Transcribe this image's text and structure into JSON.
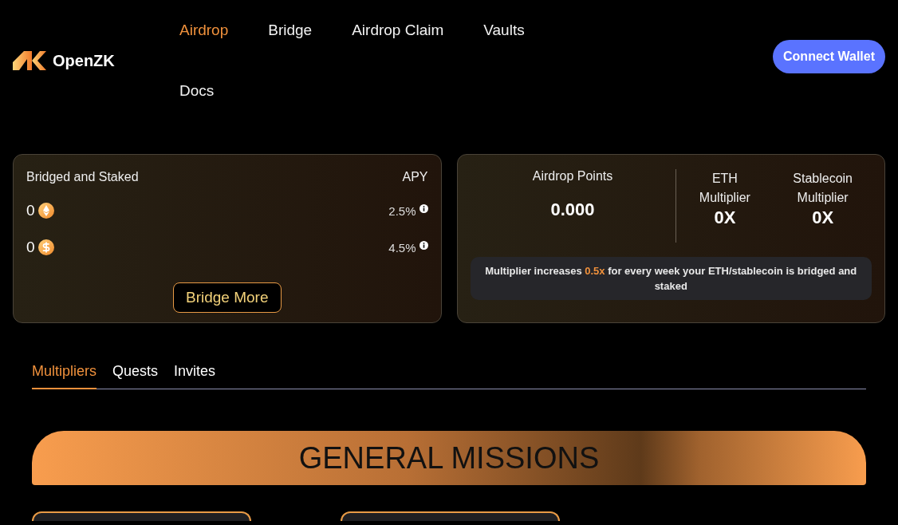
{
  "logo": {
    "name": "OpenZK"
  },
  "nav": [
    {
      "label": "Airdrop",
      "selected": true
    },
    {
      "label": "Bridge",
      "selected": false
    },
    {
      "label": "Airdrop Claim",
      "selected": false
    },
    {
      "label": "Vaults",
      "selected": false
    },
    {
      "label": "Docs",
      "selected": false
    }
  ],
  "connect_button": "Connect Wallet",
  "staked_card": {
    "title": "Bridged and Staked",
    "apy_header": "APY",
    "assets": [
      {
        "kind": "eth",
        "amount": "0",
        "apy": "2.5%"
      },
      {
        "kind": "usd",
        "amount": "0",
        "apy": "4.5%"
      }
    ],
    "button": "Bridge More"
  },
  "points_card": {
    "points_label": "Airdrop Points",
    "points_value": "0.000",
    "multipliers": [
      {
        "label": "ETH Multiplier",
        "value": "0X"
      },
      {
        "label": "Stablecoin Multiplier",
        "value": "0X"
      }
    ],
    "note": "Multiplier increases **0.5x** for every week your ETH/stablecoin is bridged and staked"
  },
  "tabs": [
    {
      "label": "Multipliers",
      "selected": true
    },
    {
      "label": "Quests",
      "selected": false
    },
    {
      "label": "Invites",
      "selected": false
    }
  ],
  "missions": {
    "title": "GENERAL MISSIONS"
  }
}
